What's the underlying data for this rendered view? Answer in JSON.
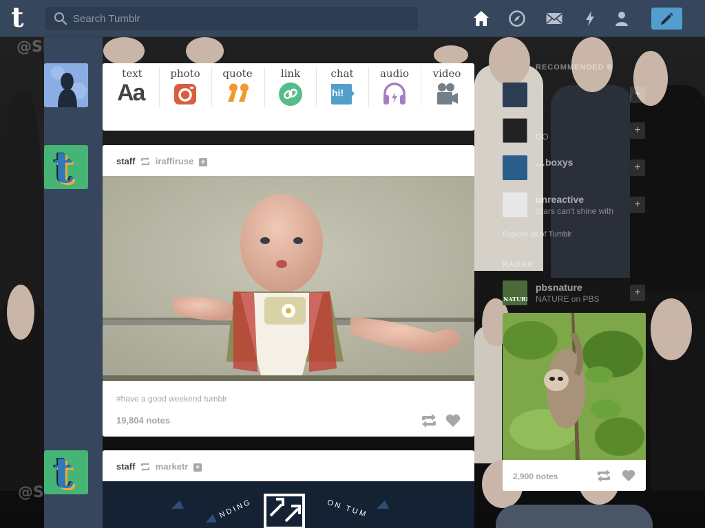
{
  "topbar": {
    "logo_letter": "t",
    "search_placeholder": "Search Tumblr",
    "icons": [
      "home-icon",
      "explore-compass-icon",
      "inbox-mail-icon",
      "activity-lightning-icon",
      "account-person-icon",
      "compose-pencil-icon"
    ]
  },
  "background": {
    "watermarks": [
      "@Sh",
      "@Sh"
    ]
  },
  "post_form": {
    "items": [
      {
        "label": "text",
        "glyph": "Aa",
        "color": "#444444"
      },
      {
        "label": "photo",
        "color": "#d95e40"
      },
      {
        "label": "quote",
        "glyph": "❝",
        "color": "#f2992e"
      },
      {
        "label": "link",
        "color": "#56bc8a"
      },
      {
        "label": "chat",
        "glyph": "hi!",
        "color": "#529ecc"
      },
      {
        "label": "audio",
        "color": "#a77dc2"
      },
      {
        "label": "video",
        "color": "#748089"
      }
    ]
  },
  "posts": [
    {
      "author": "staff",
      "reblogged_from": "iraffiruse",
      "tags": "#have a good weekend tumblr",
      "notes": "19,804 notes"
    },
    {
      "author": "staff",
      "reblogged_from": "marketr",
      "banner_words": [
        "NDING",
        "ON TUM"
      ]
    }
  ],
  "sidebar": {
    "recommended_heading": "RECOMMENDED B",
    "recommended": [
      {
        "name": "",
        "sub": ""
      },
      {
        "name": "",
        "sub": "GO"
      },
      {
        "name": "…boxys",
        "sub": ""
      },
      {
        "name": "unreactive",
        "sub": "Stars can't shine with"
      }
    ],
    "explore": "Explore all of Tumblr",
    "radar_heading": "RADAR",
    "radar": {
      "name": "pbsnature",
      "sub": "NATURE on PBS",
      "thumb_text": "NATURE",
      "notes": "2,900 notes"
    }
  }
}
